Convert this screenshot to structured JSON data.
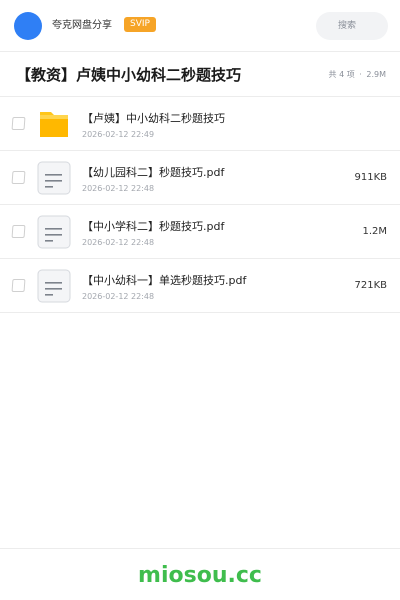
{
  "header": {
    "username": "夸克网盘分享",
    "badge": "SVIP",
    "search_placeholder": "搜索"
  },
  "folder": {
    "title": "【教资】卢姨中小幼科二秒题技巧",
    "item_count": "共 4 项",
    "separator": "·",
    "total_size": "2.9M"
  },
  "files": [
    {
      "type": "folder",
      "icon": "folder-icon",
      "name": "【卢姨】中小幼科二秒题技巧",
      "date": "2026-02-12 22:49",
      "size": ""
    },
    {
      "type": "pdf",
      "icon": "document-icon",
      "name": "【幼儿园科二】秒题技巧.pdf",
      "date": "2026-02-12 22:48",
      "size": "911KB"
    },
    {
      "type": "pdf",
      "icon": "document-icon",
      "name": "【中小学科二】秒题技巧.pdf",
      "date": "2026-02-12 22:48",
      "size": "1.2M"
    },
    {
      "type": "pdf",
      "icon": "document-icon",
      "name": "【中小幼科一】单选秒题技巧.pdf",
      "date": "2026-02-12 22:48",
      "size": "721KB"
    }
  ],
  "footer": {
    "watermark": "miosou.cc"
  },
  "colors": {
    "avatar": "#2f7ff5",
    "badge": "#f6a427",
    "folder": "#ffc61a",
    "watermark": "#3fbd4d"
  }
}
